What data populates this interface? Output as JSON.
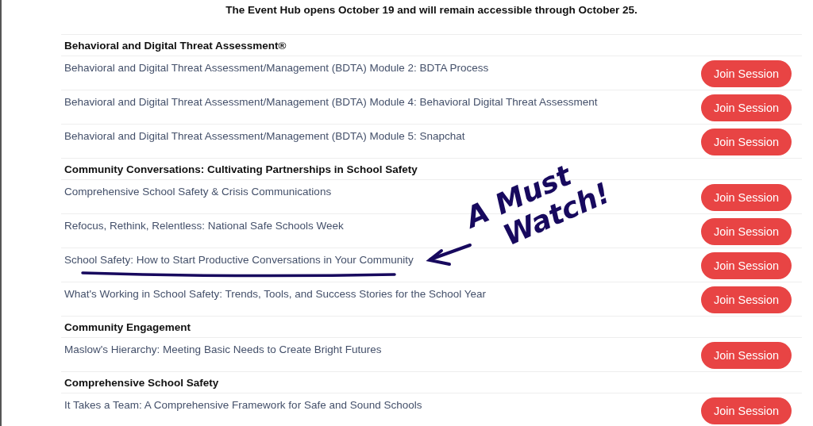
{
  "notice": "The Event Hub opens October 19 and will remain accessible through October 25.",
  "sections": [
    {
      "title": "Behavioral and Digital Threat Assessment®",
      "sessions": [
        {
          "title": "Behavioral and Digital Threat Assessment/Management (BDTA) Module 2: BDTA Process",
          "button": "Join Session"
        },
        {
          "title": "Behavioral and Digital Threat Assessment/Management (BDTA) Module 4: Behavioral Digital Threat Assessment",
          "button": "Join Session"
        },
        {
          "title": "Behavioral and Digital Threat Assessment/Management (BDTA) Module 5: Snapchat",
          "button": "Join Session"
        }
      ]
    },
    {
      "title": "Community Conversations: Cultivating Partnerships in School Safety",
      "sessions": [
        {
          "title": "Comprehensive School Safety & Crisis Communications",
          "button": "Join Session"
        },
        {
          "title": "Refocus, Rethink, Relentless: National Safe Schools Week",
          "button": "Join Session"
        },
        {
          "title": "School Safety: How to Start Productive Conversations in Your Community",
          "button": "Join Session"
        },
        {
          "title": "What's Working in School Safety: Trends, Tools, and Success Stories for the School Year",
          "button": "Join Session"
        }
      ]
    },
    {
      "title": "Community Engagement",
      "sessions": [
        {
          "title": "Maslow's Hierarchy: Meeting Basic Needs to Create Bright Futures",
          "button": "Join Session"
        }
      ]
    },
    {
      "title": "Comprehensive School Safety",
      "sessions": [
        {
          "title": "It Takes a Team: A Comprehensive Framework for Safe and Sound Schools",
          "button": "Join Session"
        }
      ]
    }
  ],
  "annotation": {
    "lines": [
      "A Must",
      "Watch!"
    ]
  }
}
